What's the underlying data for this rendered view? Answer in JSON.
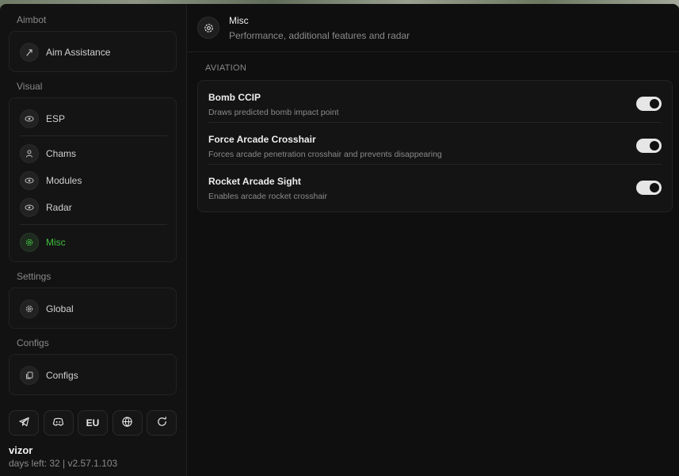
{
  "sidebar": {
    "sections": {
      "aimbot": "Aimbot",
      "visual": "Visual",
      "settings": "Settings",
      "configs": "Configs"
    },
    "items": {
      "aim_assistance": "Aim Assistance",
      "esp": "ESP",
      "chams": "Chams",
      "modules": "Modules",
      "radar": "Radar",
      "misc": "Misc",
      "global": "Global",
      "configs": "Configs"
    },
    "active_item": "Misc",
    "accent_color": "#3fbf3f",
    "bottom_buttons": {
      "telegram_icon": "telegram-icon",
      "discord_icon": "discord-icon",
      "region_label": "EU",
      "globe_icon": "globe-icon",
      "refresh_icon": "refresh-icon"
    },
    "user": {
      "name": "vizor",
      "info": "days left: 32 | v2.57.1.103"
    }
  },
  "header": {
    "icon": "gear-icon",
    "title": "Misc",
    "subtitle": "Performance, additional features and radar"
  },
  "main": {
    "category": "AVIATION",
    "settings": [
      {
        "title": "Bomb CCIP",
        "description": "Draws predicted bomb impact point",
        "enabled": true
      },
      {
        "title": "Force Arcade Crosshair",
        "description": "Forces arcade penetration crosshair and prevents disappearing",
        "enabled": true
      },
      {
        "title": "Rocket Arcade Sight",
        "description": "Enables arcade rocket crosshair",
        "enabled": true
      }
    ]
  }
}
